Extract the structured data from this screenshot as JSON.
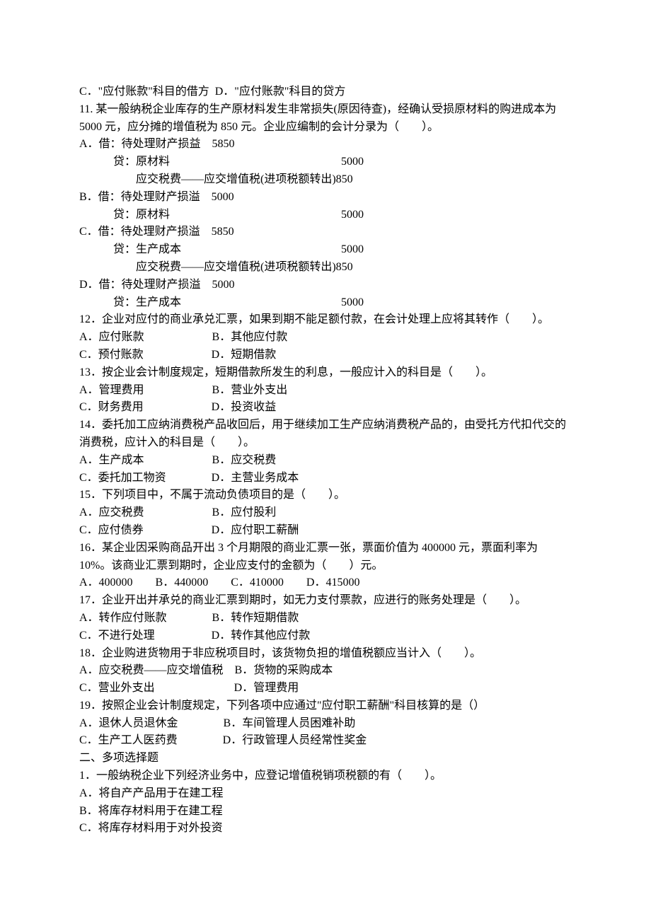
{
  "lines": {
    "l01": "C．\"应付账款\"科目的借方  D．\"应付账款\"科目的贷方",
    "l02": "11. 某一般纳税企业库存的生产原材料发生非常损失(原因待查)，经确认受损原材料的购进成本为 5000 元，应分摊的增值税为 850 元。企业应编制的会计分录为（　　）。",
    "l03a": "A．借：待处理财产损益　5850",
    "l03b_left": "　　　贷：原材料",
    "l03b_right": "5000",
    "l03c": "　　　　　应交税费——应交增值税(进项税额转出)850",
    "l04a": "B．借：待处理财产损溢　5000",
    "l04b_left": "　　　贷：原材料",
    "l04b_right": "5000",
    "l05a": "C．借：待处理财产损溢　5850",
    "l05b_left": "　　　贷：生产成本",
    "l05b_right": "5000",
    "l05c": "　　　　　应交税费——应交增值税(进项税额转出)850",
    "l06a": "D．借：待处理财产损溢　5000",
    "l06b_left": "　　　贷：生产成本",
    "l06b_right": "5000",
    "l07": "12．企业对应付的商业承兑汇票，如果到期不能足额付款，在会计处理上应将其转作（　　）。",
    "l08": "A．应付账款　　　　　　B．其他应付款",
    "l09": "C．预付账款　　　　　　D．短期借款",
    "l10": "13．按企业会计制度规定，短期借款所发生的利息，一般应计入的科目是（　　）。",
    "l11": "A．管理费用　　　　　　B．营业外支出",
    "l12": "C．财务费用　　　　　　D．投资收益",
    "l13": "14．委托加工应纳消费税产品收回后，用于继续加工生产应纳消费税产品的，由受托方代扣代交的消费税，应计入的科目是（　　）。",
    "l14": "A．生产成本　　　　　　B．应交税费",
    "l15": "C．委托加工物资　　　　D．主营业务成本",
    "l16": "15．下列项目中，不属于流动负债项目的是（　　）。",
    "l17": "A．应交税费　　　　　　B．应付股利",
    "l18": "C．应付债券　　　　　　D．应付职工薪酬",
    "l19": "16．某企业因采购商品开出 3 个月期限的商业汇票一张，票面价值为 400000 元，票面利率为 10%。该商业汇票到期时，企业应支付的金额为（　　）元。",
    "l20": "A．400000　　B．440000　　C．410000　　D．415000",
    "l21": "17．企业开出并承兑的商业汇票到期时，如无力支付票款，应进行的账务处理是（　　）。",
    "l22": "A．转作应付账款　　　　B．转作短期借款",
    "l23": "C．不进行处理　　　　　D．转作其他应付款",
    "l24": "18．企业购进货物用于非应税项目时，该货物负担的增值税额应当计入（　　）。",
    "l25": "A．应交税费——应交增值税　B．货物的采购成本",
    "l26": "C．营业外支出　　　　　　　D．管理费用",
    "l27": "19．按照企业会计制度规定，下列各项中应通过\"应付职工薪酬\"科目核算的是（）",
    "l28": "A．退休人员退休金　　　　B．车间管理人员困难补助",
    "l29": "C．生产工人医药费　　　　D．行政管理人员经常性奖金",
    "l30": "二、多项选择题",
    "l31": "1．一般纳税企业下列经济业务中，应登记增值税销项税额的有（　　）。",
    "l32": "A．将自产产品用于在建工程",
    "l33": "B．将库存材料用于在建工程",
    "l34": "C．将库存材料用于对外投资"
  }
}
